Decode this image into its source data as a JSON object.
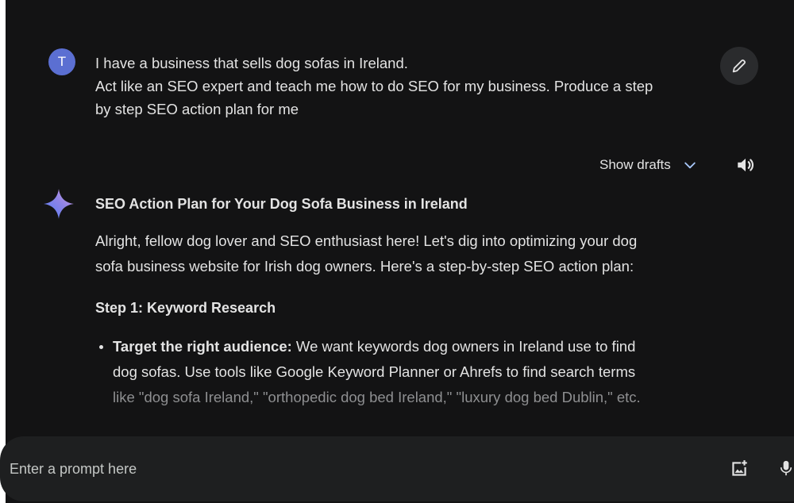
{
  "user_message": {
    "avatar_letter": "T",
    "lines": [
      "I have a business that sells dog sofas in Ireland.",
      "Act like an SEO expert and teach me how to do SEO for my business. Produce a step",
      "by step SEO action plan for me"
    ]
  },
  "toolbar": {
    "show_drafts_label": "Show drafts",
    "edit_icon": "pencil-icon",
    "speaker_icon": "speaker-icon"
  },
  "response": {
    "title": "SEO Action Plan for Your Dog Sofa Business in Ireland",
    "intro_lines": [
      "Alright, fellow dog lover and SEO enthusiast here! Let's dig into optimizing your dog",
      "sofa business website for Irish dog owners. Here's a step-by-step SEO action plan:"
    ],
    "step1_title": "Step 1: Keyword Research",
    "bullet1": {
      "lead": "Target the right audience:",
      "line1_rest": " We want keywords dog owners in Ireland use to find",
      "line2": "dog sofas. Use tools like Google Keyword Planner or Ahrefs to find search terms",
      "line3": "like \"dog sofa Ireland,\" \"orthopedic dog bed Ireland,\" \"luxury dog bed Dublin,\" etc."
    }
  },
  "prompt": {
    "placeholder": "Enter a prompt here",
    "image_icon": "add-image-icon",
    "mic_icon": "mic-icon"
  },
  "colors": {
    "background": "#131314",
    "prompt_bar": "#1e1f20",
    "text": "#e3e3e3",
    "avatar": "#5b6fd2",
    "accent_chevron": "#a8c7fa"
  }
}
